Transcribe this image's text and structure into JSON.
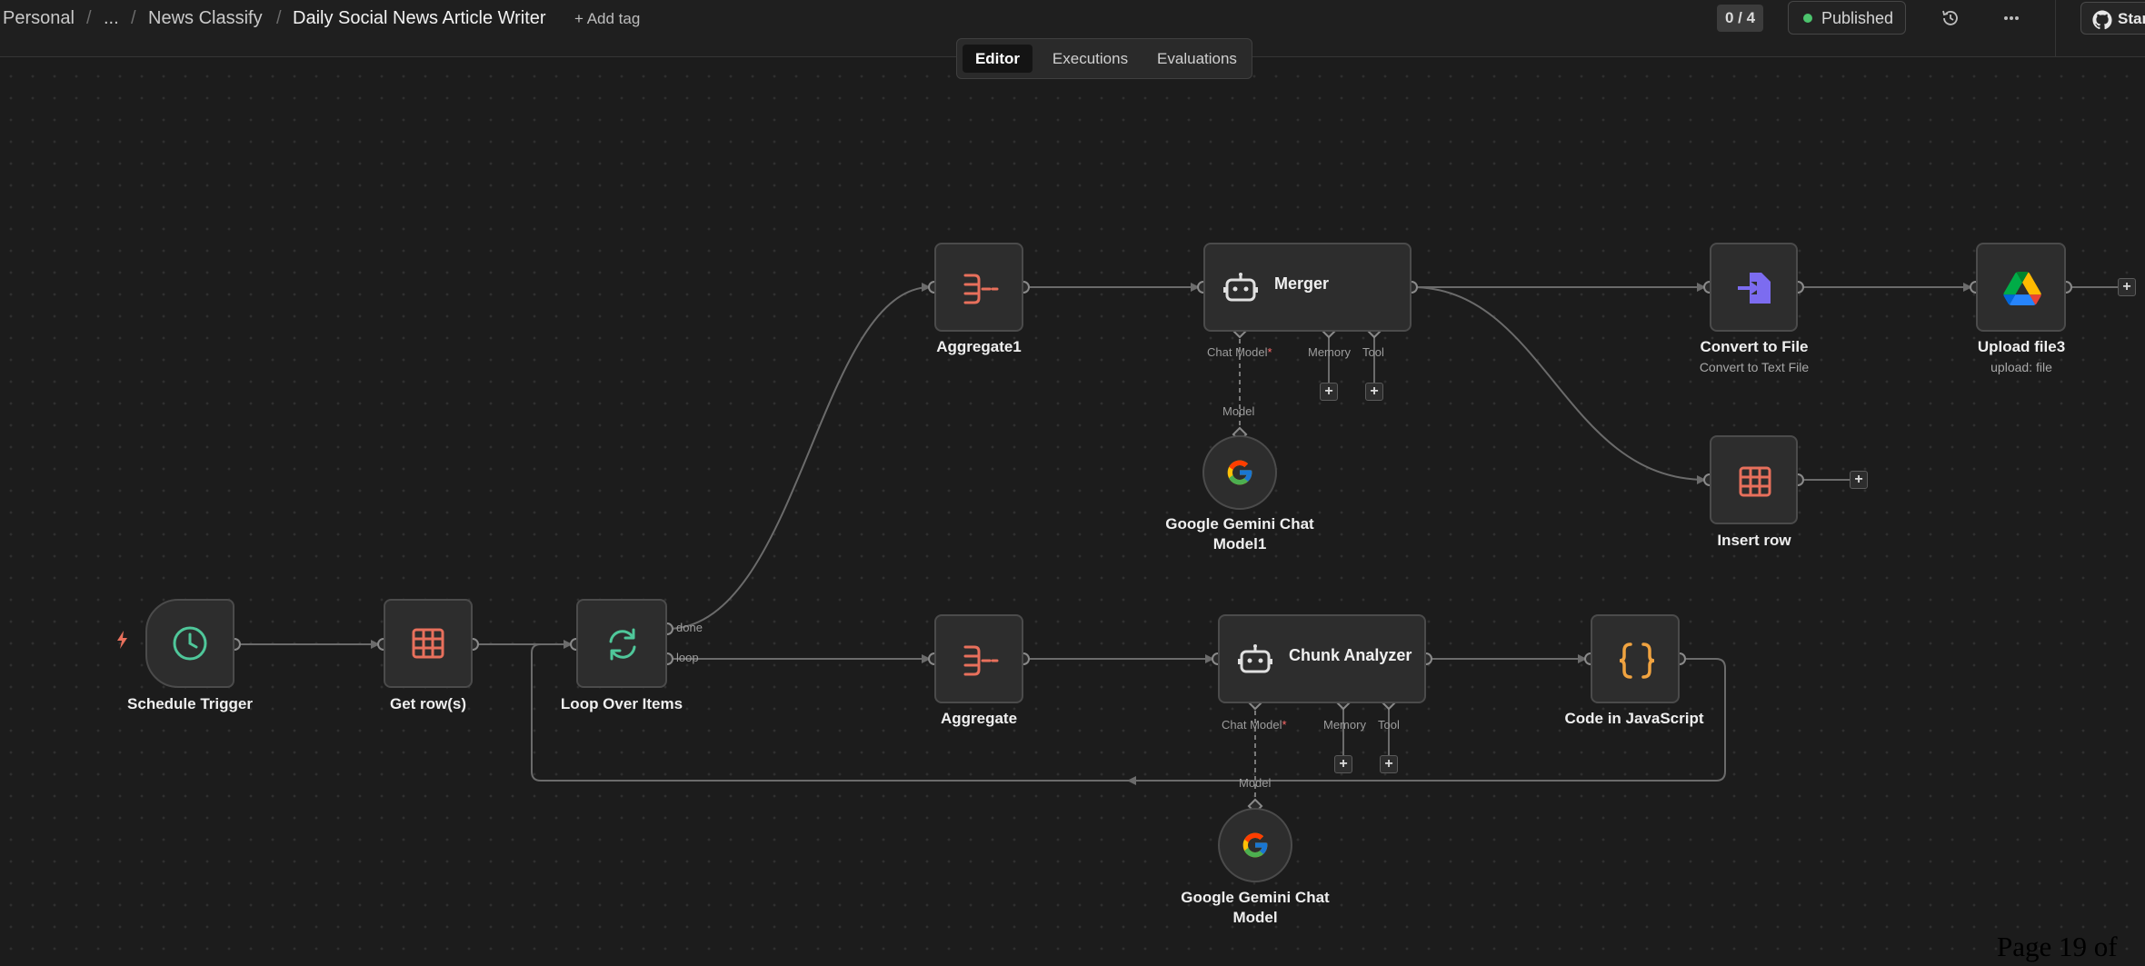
{
  "breadcrumb": {
    "items": [
      "Personal",
      "...",
      "News Classify",
      "Daily Social News Article Writer"
    ],
    "separator": "/",
    "add_tag": "+ Add tag"
  },
  "header": {
    "counter": "0 / 4",
    "status": "Published",
    "history_icon": "history-icon",
    "more_icon": "more-horizontal-icon",
    "github": {
      "icon": "github-icon",
      "label": "Star"
    }
  },
  "tabs": [
    {
      "label": "Editor",
      "active": true
    },
    {
      "label": "Executions",
      "active": false
    },
    {
      "label": "Evaluations",
      "active": false
    }
  ],
  "nodes": {
    "schedule_trigger": {
      "label": "Schedule Trigger",
      "icon": "clock-icon"
    },
    "get_rows": {
      "label": "Get row(s)",
      "icon": "table-icon"
    },
    "loop_over_items": {
      "label": "Loop Over Items",
      "icon": "loop-icon",
      "outputs": [
        "done",
        "loop"
      ]
    },
    "aggregate1": {
      "label": "Aggregate1",
      "icon": "aggregate-icon"
    },
    "aggregate": {
      "label": "Aggregate",
      "icon": "aggregate-icon"
    },
    "merger": {
      "title": "Merger",
      "icon": "robot-icon",
      "ports": [
        "Chat Model",
        "Memory",
        "Tool"
      ]
    },
    "chunk_analyzer": {
      "title": "Chunk Analyzer",
      "icon": "robot-icon",
      "ports": [
        "Chat Model",
        "Memory",
        "Tool"
      ]
    },
    "gemini1": {
      "label": "Google Gemini Chat Model1",
      "lines": [
        "Google Gemini Chat",
        "Model1"
      ],
      "icon": "google-icon",
      "port": "Model"
    },
    "gemini": {
      "label": "Google Gemini Chat Model",
      "lines": [
        "Google Gemini Chat",
        "Model"
      ],
      "icon": "google-icon",
      "port": "Model"
    },
    "convert_to_file": {
      "label": "Convert to File",
      "subtitle": "Convert to Text File",
      "icon": "file-import-icon"
    },
    "upload_file3": {
      "label": "Upload file3",
      "subtitle": "upload: file",
      "icon": "google-drive-icon"
    },
    "insert_row": {
      "label": "Insert row",
      "icon": "table-icon"
    },
    "code_js": {
      "label": "Code in JavaScript",
      "icon": "braces-icon"
    }
  },
  "colors": {
    "canvas": "#1c1c1c",
    "node_bg": "#2d2d2d",
    "node_border": "#4b4b4b",
    "edge": "#6b6b6b",
    "trigger_accent": "#4fc79a",
    "table_icon": "#e8705c",
    "published_dot": "#4cc46d",
    "code_icon": "#f0a340",
    "convert_icon": "#7c6cf0",
    "required": "#ff6b6b"
  },
  "footer": {
    "page_text": "Page 19 of"
  }
}
